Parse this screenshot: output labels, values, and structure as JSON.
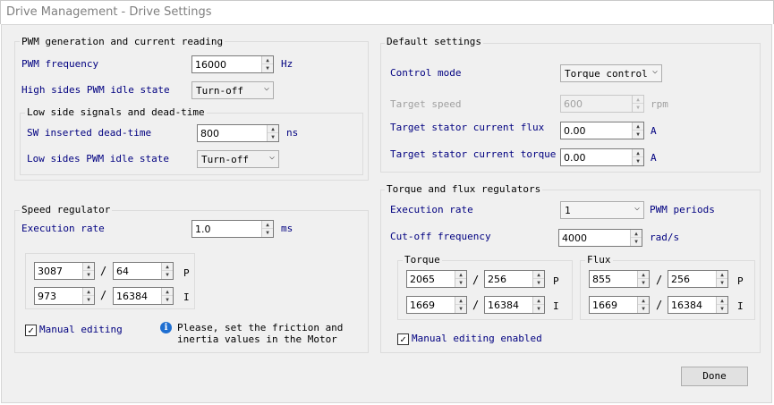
{
  "window": {
    "title": "Drive Management - Drive Settings"
  },
  "pwm": {
    "title": "PWM generation and current reading",
    "frequency": {
      "label": "PWM frequency",
      "value": "16000",
      "unit": "Hz"
    },
    "high_idle": {
      "label": "High sides PWM idle state",
      "value": "Turn-off"
    },
    "low_side": {
      "title": "Low side signals and dead-time",
      "deadtime": {
        "label": "SW inserted dead-time",
        "value": "800",
        "unit": "ns"
      },
      "low_idle": {
        "label": "Low sides PWM idle state",
        "value": "Turn-off"
      }
    }
  },
  "speed": {
    "title": "Speed regulator",
    "exec": {
      "label": "Execution rate",
      "value": "1.0",
      "unit": "ms"
    },
    "p_num": "3087",
    "p_den": "64",
    "p_label": "P",
    "i_num": "973",
    "i_den": "16384",
    "i_label": "I",
    "slash": "/",
    "manual": {
      "label": "Manual editing",
      "checked": true,
      "mark": "✓"
    },
    "info": {
      "icon": "i",
      "line1": "Please, set the friction and",
      "line2": "inertia values in the Motor"
    }
  },
  "defaults": {
    "title": "Default settings",
    "control_mode": {
      "label": "Control mode",
      "value": "Torque control"
    },
    "target_speed": {
      "label": "Target speed",
      "value": "600",
      "unit": "rpm"
    },
    "flux": {
      "label": "Target stator current flux",
      "value": "0.00",
      "unit": "A"
    },
    "torque": {
      "label": "Target stator current torque",
      "value": "0.00",
      "unit": "A"
    }
  },
  "tf": {
    "title": "Torque and flux regulators",
    "exec": {
      "label": "Execution rate",
      "value": "1",
      "unit": "PWM periods"
    },
    "cutoff": {
      "label": "Cut-off frequency",
      "value": "4000",
      "unit": "rad/s"
    },
    "torque": {
      "title": "Torque",
      "p_num": "2065",
      "p_den": "256",
      "i_num": "1669",
      "i_den": "16384"
    },
    "flux": {
      "title": "Flux",
      "p_num": "855",
      "p_den": "256",
      "i_num": "1669",
      "i_den": "16384"
    },
    "p_label": "P",
    "i_label": "I",
    "slash": "/",
    "manual": {
      "label": "Manual editing enabled",
      "checked": true,
      "mark": "✓"
    }
  },
  "done": {
    "label": "Done"
  },
  "icons": {
    "spin_up": "▲",
    "spin_down": "▼",
    "dropdown": "⌵"
  }
}
